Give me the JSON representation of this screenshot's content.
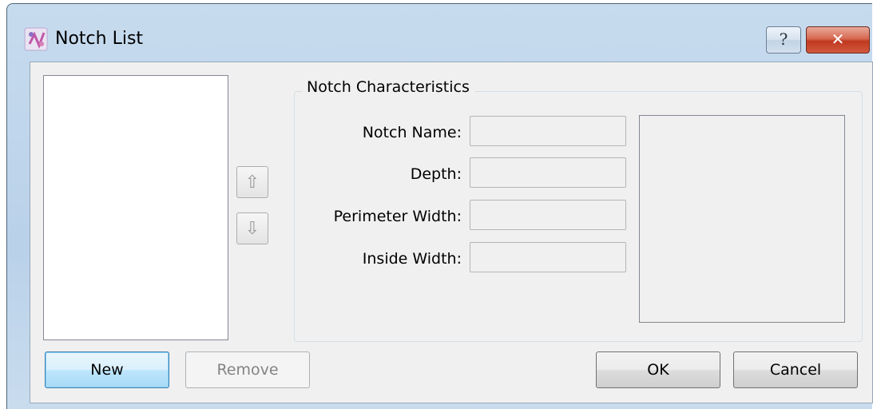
{
  "window": {
    "title": "Notch List",
    "help_label": "?",
    "close_label": "✕",
    "app_icon": "app-icon"
  },
  "list": {
    "items": [],
    "move_up_icon": "⇧",
    "move_down_icon": "⇩"
  },
  "characteristics": {
    "group_title": "Notch Characteristics",
    "fields": [
      {
        "label": "Notch Name:",
        "value": ""
      },
      {
        "label": "Depth:",
        "value": ""
      },
      {
        "label": "Perimeter Width:",
        "value": ""
      },
      {
        "label": "Inside Width:",
        "value": ""
      }
    ]
  },
  "buttons": {
    "new_label": "New",
    "remove_label": "Remove",
    "ok_label": "OK",
    "cancel_label": "Cancel"
  }
}
